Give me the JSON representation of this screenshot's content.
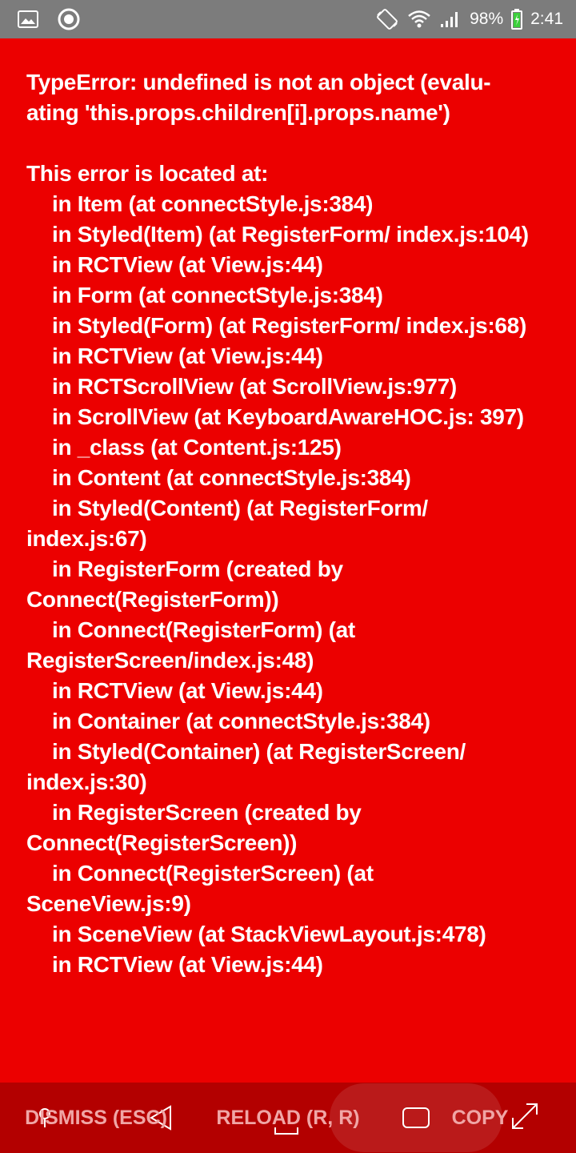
{
  "status_bar": {
    "battery": "98%",
    "time": "2:41",
    "icons": [
      "image-icon",
      "circle-icon",
      "rotate-icon",
      "wifi-icon",
      "signal-icon",
      "battery-icon"
    ]
  },
  "error": {
    "message": "TypeError: undefined is not an object (evalu-ating 'this.props.children[i].props.name')",
    "stack_lines": [
      {
        "text": "This error is located at:",
        "indent": false
      },
      {
        "text": "in Item (at connectStyle.js:384)",
        "indent": true
      },
      {
        "text": "in Styled(Item) (at RegisterForm/ index.js:104)",
        "indent": true
      },
      {
        "text": "in RCTView (at View.js:44)",
        "indent": true
      },
      {
        "text": "in Form (at connectStyle.js:384)",
        "indent": true
      },
      {
        "text": "in Styled(Form) (at RegisterForm/ index.js:68)",
        "indent": true
      },
      {
        "text": "in RCTView (at View.js:44)",
        "indent": true
      },
      {
        "text": "in RCTScrollView (at ScrollView.js:977)",
        "indent": true
      },
      {
        "text": "in ScrollView (at KeyboardAwareHOC.js: 397)",
        "indent": true
      },
      {
        "text": "in _class (at Content.js:125)",
        "indent": true
      },
      {
        "text": "in Content (at connectStyle.js:384)",
        "indent": true
      },
      {
        "text": "in Styled(Content) (at RegisterForm/ index.js:67)",
        "indent": true
      },
      {
        "text": "in RegisterForm (created by Connect(RegisterForm))",
        "indent": true
      },
      {
        "text": "in Connect(RegisterForm) (at RegisterScreen/index.js:48)",
        "indent": true
      },
      {
        "text": "in RCTView (at View.js:44)",
        "indent": true
      },
      {
        "text": "in Container (at connectStyle.js:384)",
        "indent": true
      },
      {
        "text": "in Styled(Container) (at RegisterScreen/ index.js:30)",
        "indent": true
      },
      {
        "text": "in RegisterScreen (created by Connect(RegisterScreen))",
        "indent": true
      },
      {
        "text": "in Connect(RegisterScreen) (at SceneView.js:9)",
        "indent": true
      },
      {
        "text": "in SceneView (at StackViewLayout.js:478)",
        "indent": true
      },
      {
        "text": "in RCTView (at View.js:44)",
        "indent": true
      }
    ]
  },
  "buttons": {
    "dismiss": "DISMISS (ESC)",
    "reload": "RELOAD (R, R)",
    "copy": "COPY"
  },
  "colors": {
    "background": "#ec0000",
    "status_bar": "#7c7c7c",
    "bottom_bar": "#b30000",
    "button_text": "#f0a6a6"
  }
}
